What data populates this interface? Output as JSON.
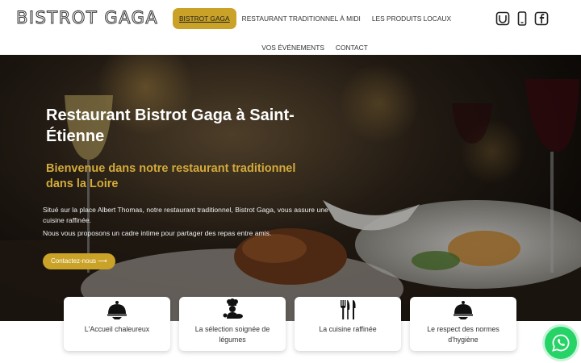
{
  "header": {
    "logo": "BISTROT GAGA",
    "nav_row1": [
      {
        "label": "BISTROT GAGA",
        "active": true
      },
      {
        "label": "RESTAURANT TRADITIONNEL À MIDI",
        "active": false
      },
      {
        "label": "LES PRODUITS LOCAUX",
        "active": false
      }
    ],
    "nav_row2": [
      {
        "label": "VOS ÉVÉNEMENTS",
        "active": false
      },
      {
        "label": "CONTACT",
        "active": false
      }
    ],
    "social_icons": [
      "uber-eats-icon",
      "phone-icon",
      "facebook-icon"
    ]
  },
  "hero": {
    "title": "Restaurant Bistrot Gaga à Saint-Étienne",
    "subtitle": "Bienvenue dans notre restaurant traditionnel dans la Loire",
    "paragraph1": "Situé sur la place Albert Thomas, notre restaurant traditionnel, Bistrot Gaga, vous assure une cuisine raffinée.",
    "paragraph2": "Nous vous proposons un cadre intime pour partager des repas entre amis.",
    "cta_label": "Contactez-nous ⟶"
  },
  "cards": [
    {
      "icon": "cloche-icon",
      "label": "L'Accueil chaleureux"
    },
    {
      "icon": "chef-vegetables-icon",
      "label": "La sélection soignée de légumes"
    },
    {
      "icon": "cutlery-icon",
      "label": "La cuisine raffinée"
    },
    {
      "icon": "cloche-icon",
      "label": "Le respect des normes d'hygiène"
    }
  ],
  "colors": {
    "accent": "#c9a227",
    "subtitle": "#d4ab3a",
    "whatsapp": "#25d366"
  },
  "floating": {
    "icon": "whatsapp-icon"
  }
}
